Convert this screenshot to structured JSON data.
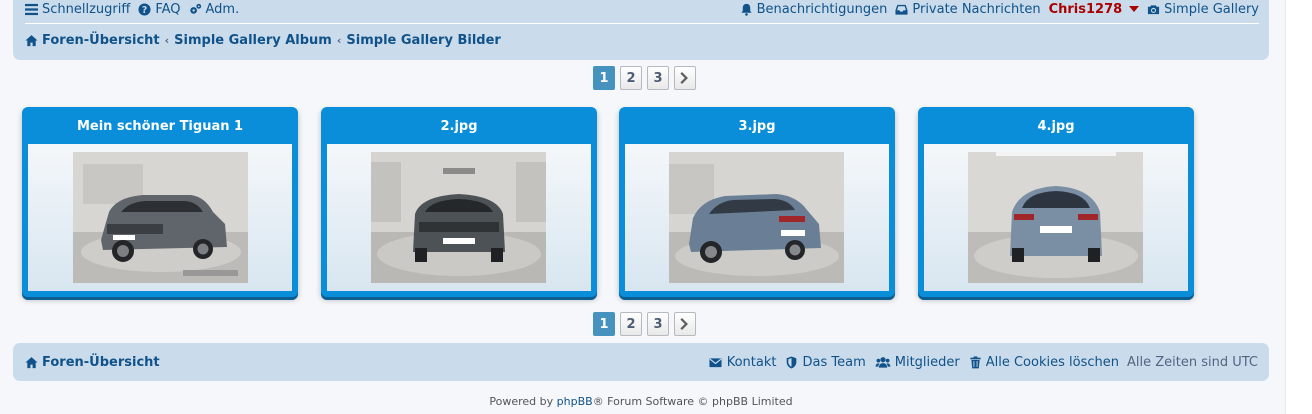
{
  "header": {
    "quick_links": "Schnellzugriff",
    "faq": "FAQ",
    "admin": "Adm.",
    "notifications": "Benachrichtigungen",
    "private_messages": "Private Nachrichten",
    "username": "Chris1278",
    "gallery": "Simple Gallery"
  },
  "breadcrumbs": [
    "Foren-Übersicht",
    "Simple Gallery Album",
    "Simple Gallery Bilder"
  ],
  "pagination": {
    "pages": [
      "1",
      "2",
      "3"
    ],
    "active": "1"
  },
  "images": [
    {
      "title": "Mein schöner Tiguan 1",
      "body_color": "#5f656b",
      "view": "front-left"
    },
    {
      "title": "2.jpg",
      "body_color": "#4d5257",
      "view": "front"
    },
    {
      "title": "3.jpg",
      "body_color": "#6a7f96",
      "view": "rear-left"
    },
    {
      "title": "4.jpg",
      "body_color": "#7a8ea4",
      "view": "rear"
    }
  ],
  "footer": {
    "index": "Foren-Übersicht",
    "contact": "Kontakt",
    "team": "Das Team",
    "members": "Mitglieder",
    "delete_cookies": "Alle Cookies löschen",
    "timezone": "Alle Zeiten sind UTC"
  },
  "copyright": {
    "prefix": "Powered by",
    "link": "phpBB",
    "suffix": "® Forum Software © phpBB Limited"
  },
  "colors": {
    "link": "#105289",
    "panel": "#cadceb",
    "card": "#0a8ed9",
    "username": "#aa0000",
    "pagination_active": "#4692bf"
  }
}
